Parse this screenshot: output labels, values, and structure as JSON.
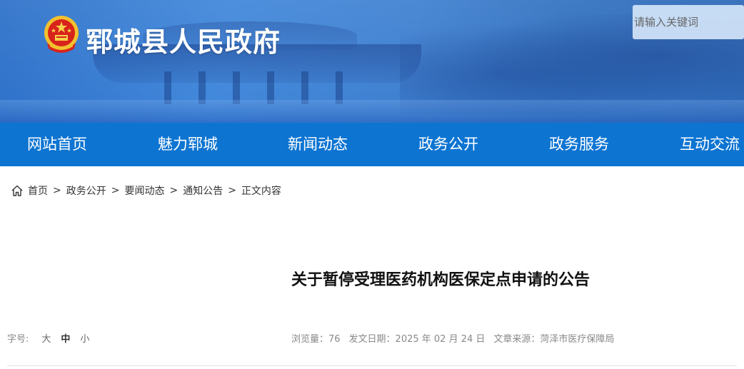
{
  "header": {
    "site_title": "郓城县人民政府",
    "search_placeholder": "请输入关键词"
  },
  "nav": {
    "items": [
      "网站首页",
      "魅力郓城",
      "新闻动态",
      "政务公开",
      "政务服务",
      "互动交流"
    ]
  },
  "breadcrumb": {
    "items": [
      "首页",
      "政务公开",
      "要闻动态",
      "通知公告",
      "正文内容"
    ],
    "separator": ">"
  },
  "article": {
    "title": "关于暂停受理医药机构医保定点申请的公告",
    "font_size_label": "字号:",
    "font_sizes": [
      "大",
      "中",
      "小"
    ],
    "views": "浏览量：76",
    "publish_date": "发文日期：2025 年 02 月 24 日",
    "source": "文章来源：菏泽市医疗保障局"
  },
  "colors": {
    "nav_background": "#0d74d2",
    "banner_blue": "#3f86da"
  }
}
